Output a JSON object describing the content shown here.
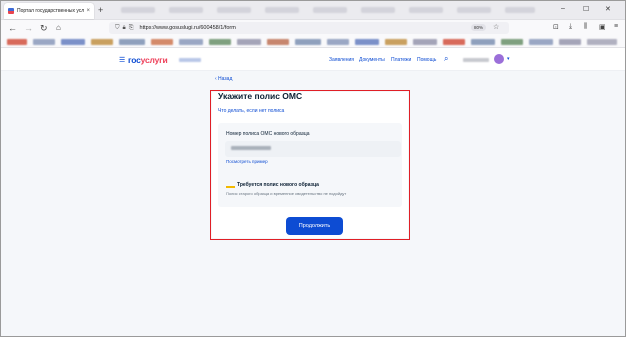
{
  "browser": {
    "tab_title": "Портал государственных услуг",
    "tab_close": "×",
    "new_tab": "+",
    "url": "https://www.gosuslugi.ru/600458/1/form",
    "zoom": "80%",
    "min_glyph": "–",
    "max_glyph": "☐",
    "close_glyph": "✕",
    "icons": [
      "back-icon",
      "forward-icon",
      "reload-icon",
      "home-icon",
      "shield-icon",
      "lock-icon",
      "star-icon",
      "bookmark-icon",
      "download-icon",
      "library-icon",
      "extension-icon",
      "menu-icon"
    ]
  },
  "site": {
    "logo_part1": "гос",
    "logo_part2": "услуги",
    "brand_blue": "#0d4cd3",
    "brand_red": "#ee3f58",
    "menu": [
      "Заявления",
      "Документы",
      "Платежи",
      "Помощь"
    ]
  },
  "form": {
    "back_label": "‹ Назад",
    "title": "Укажите полис ОМС",
    "help_link": "Что делать, если нет полиса",
    "field_label": "Номер полиса ОМС нового образца",
    "example_link": "Посмотреть пример",
    "warning_title": "Требуется полис нового образца",
    "warning_text": "Полис старого образца и временное свидетельство не подойдут",
    "continue_label": "Продолжить",
    "highlight_color": "#e01f26"
  }
}
